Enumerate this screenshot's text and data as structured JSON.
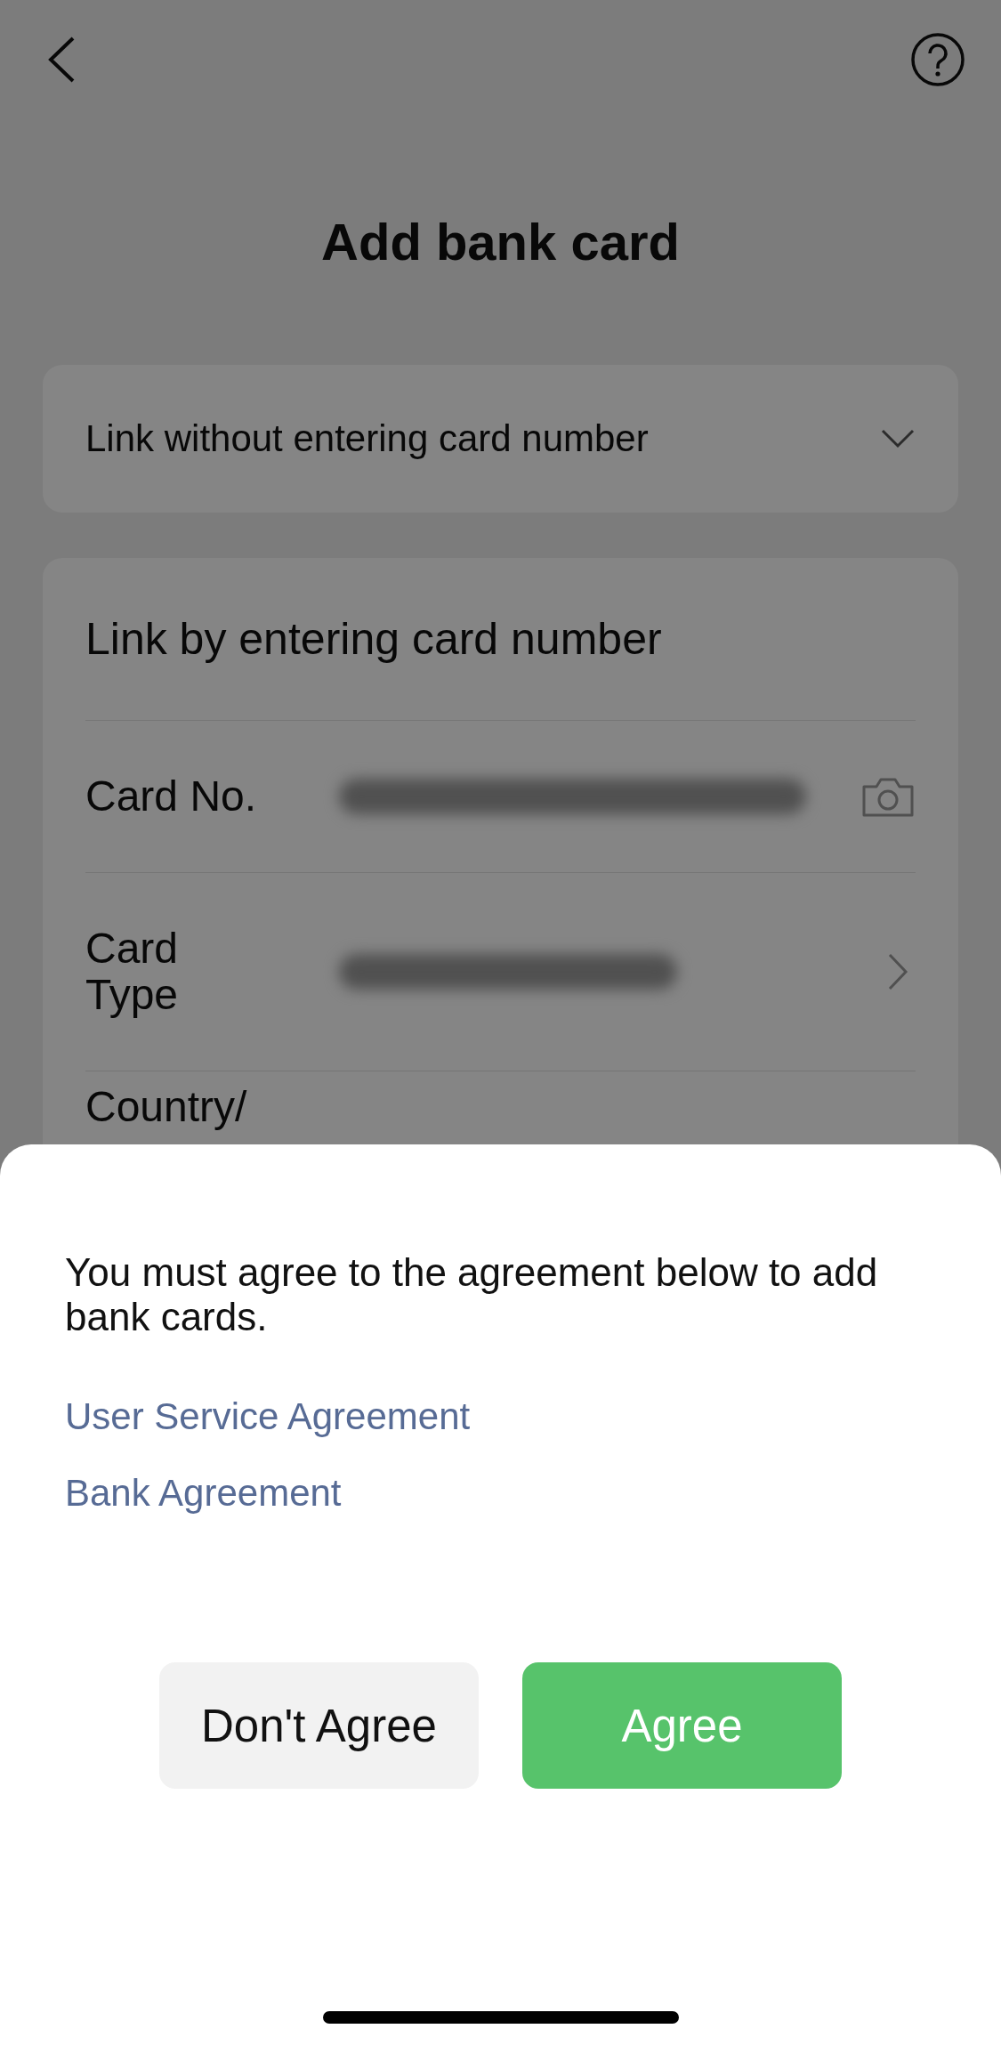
{
  "title": "Add bank card",
  "collapsed_section": {
    "label": "Link without entering card number",
    "expanded": false
  },
  "card_form": {
    "title": "Link by entering card number",
    "rows": [
      {
        "label": "Card No.",
        "kind": "camera"
      },
      {
        "label": "Card Type",
        "kind": "chevron"
      },
      {
        "label": "Country/",
        "kind": "partial"
      }
    ]
  },
  "sheet": {
    "message": "You must agree to the agreement below to add bank cards.",
    "links": [
      "User Service Agreement",
      "Bank Agreement"
    ],
    "buttons": [
      {
        "label": "Don't Agree",
        "kind": "secondary"
      },
      {
        "label": "Agree",
        "kind": "primary"
      }
    ]
  }
}
